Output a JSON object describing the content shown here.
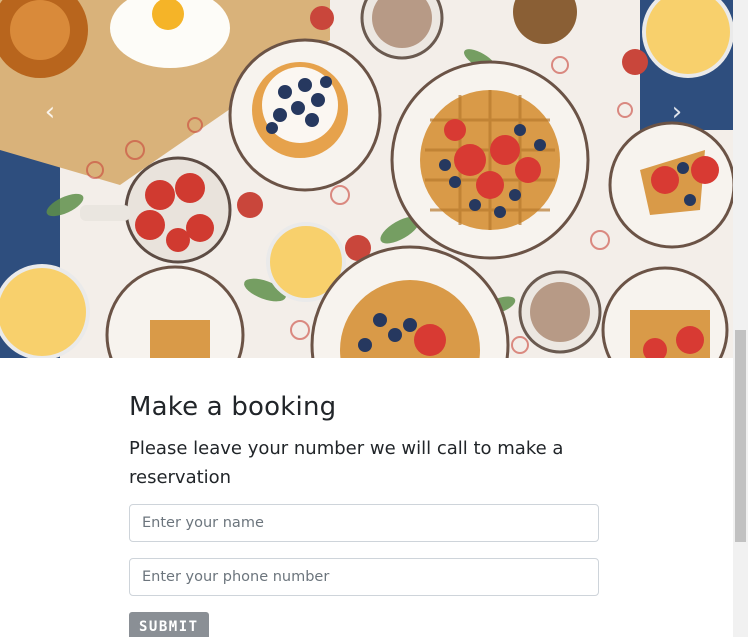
{
  "hero": {
    "image_alt": "Breakfast table with waffles, berries, coffee and orange juice",
    "prev_icon": "chevron-left-icon",
    "next_icon": "chevron-right-icon"
  },
  "booking": {
    "title": "Make a booking",
    "description": "Please leave your number we will call to make a reservation",
    "name_placeholder": "Enter your name",
    "phone_placeholder": "Enter your phone number",
    "submit_label": "SUBMIT"
  },
  "colors": {
    "submit_bg": "#8a8f95",
    "text": "#212529",
    "input_border": "#ced4da"
  }
}
